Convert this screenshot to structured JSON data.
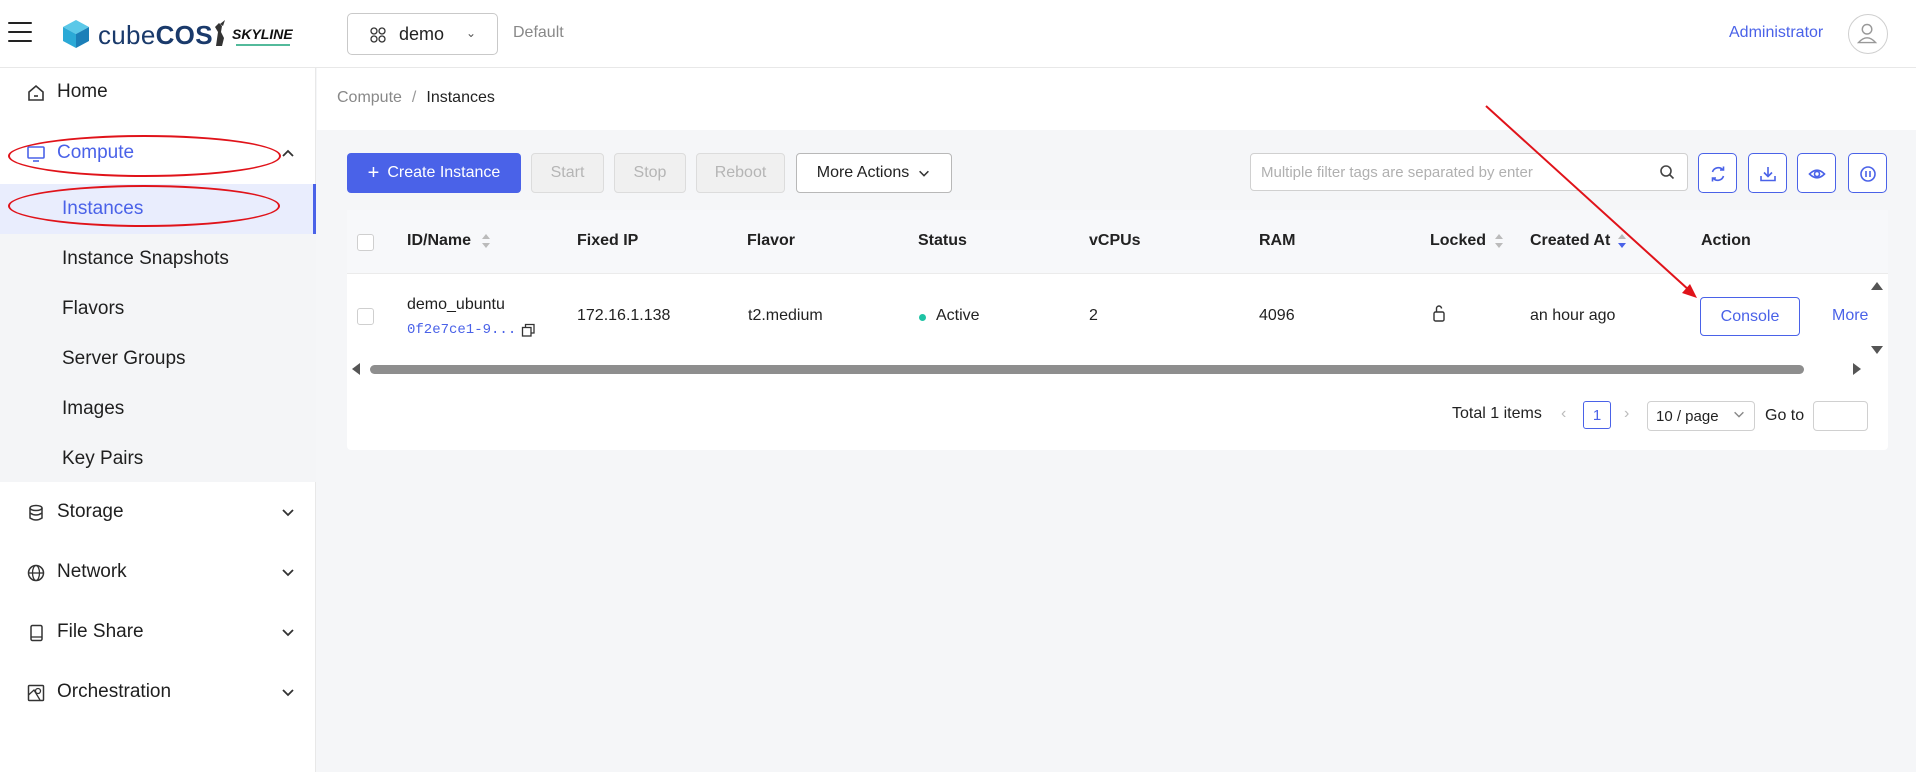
{
  "header": {
    "brand": "cubeCOS",
    "brand_part1": "cube",
    "brand_part2": "COS",
    "partner_logo_text": "SKYLINE",
    "project": "demo",
    "domain": "Default",
    "user": "Administrator"
  },
  "sidebar": {
    "home": "Home",
    "compute": "Compute",
    "compute_items": [
      "Instances",
      "Instance Snapshots",
      "Flavors",
      "Server Groups",
      "Images",
      "Key Pairs"
    ],
    "storage": "Storage",
    "network": "Network",
    "file_share": "File Share",
    "orchestration": "Orchestration"
  },
  "breadcrumb": {
    "parent": "Compute",
    "separator": "/",
    "current": "Instances"
  },
  "toolbar": {
    "create_label": "Create Instance",
    "start_label": "Start",
    "stop_label": "Stop",
    "reboot_label": "Reboot",
    "more_actions_label": "More Actions",
    "search_placeholder": "Multiple filter tags are separated by enter",
    "icons": [
      "refresh-icon",
      "download-icon",
      "eye-icon",
      "pause-icon"
    ]
  },
  "table": {
    "columns": [
      "ID/Name",
      "Fixed IP",
      "Flavor",
      "Status",
      "vCPUs",
      "RAM",
      "Locked",
      "Created At",
      "Action"
    ],
    "rows": [
      {
        "name": "demo_ubuntu",
        "id": "0f2e7ce1-9...",
        "fixed_ip": "172.16.1.138",
        "flavor": "t2.medium",
        "status": "Active",
        "vcpus": "2",
        "ram": "4096",
        "locked_icon": "unlock-icon",
        "created_at": "an hour ago",
        "console_label": "Console",
        "more_label": "More"
      }
    ]
  },
  "pagination": {
    "total": "Total 1 items",
    "current_page": "1",
    "page_size": "10 / page",
    "goto_label": "Go to"
  },
  "colors": {
    "accent": "#4a62e8",
    "annotation": "#e0131a",
    "status_active": "#1ec3a4"
  }
}
